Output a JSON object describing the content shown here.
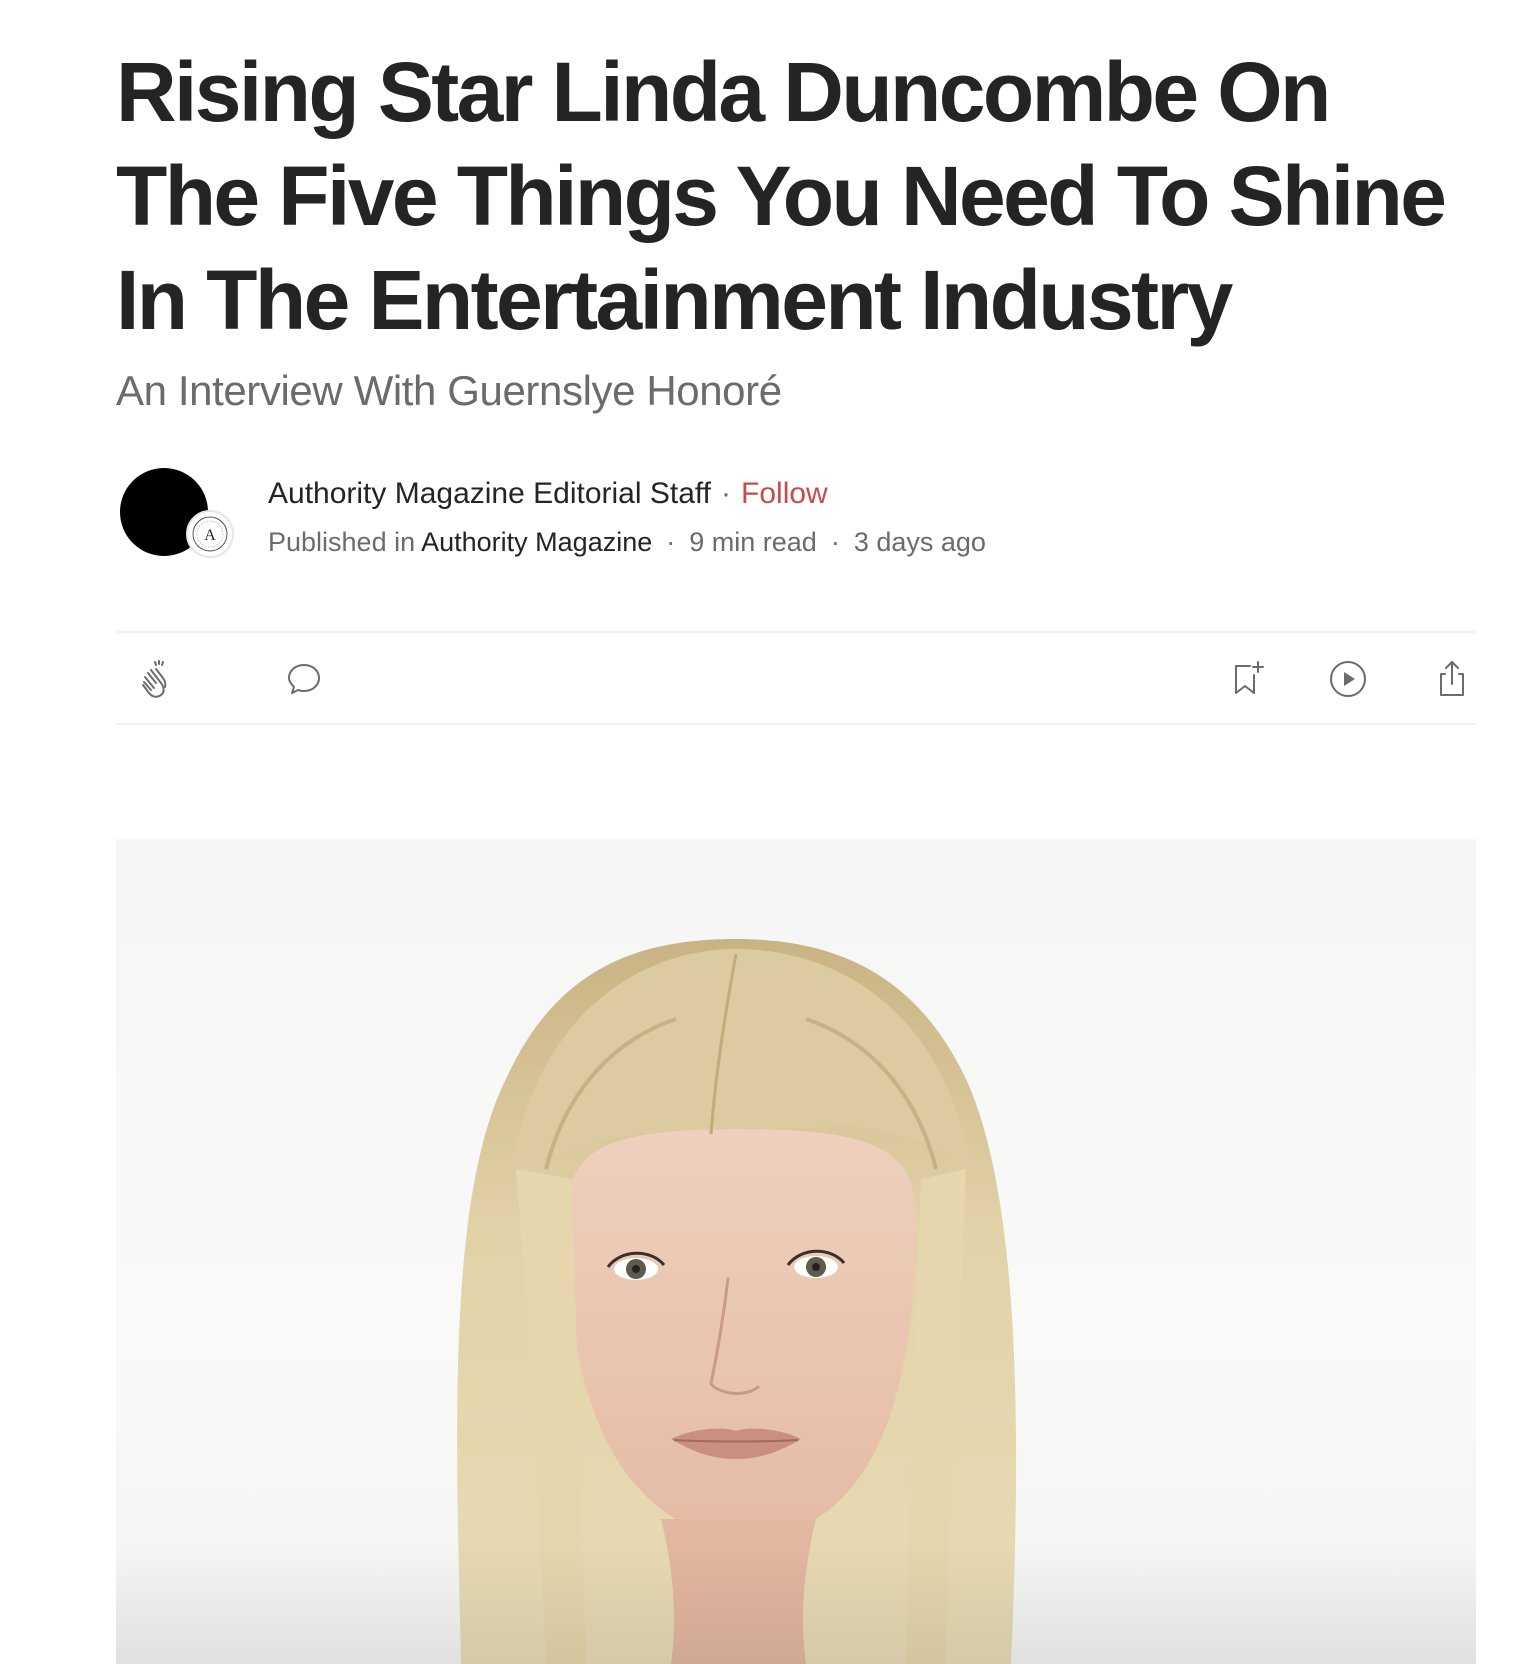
{
  "article": {
    "title": "Rising Star Linda Duncombe On The Five Things You Need To Shine In The Entertainment Industry",
    "subtitle": "An Interview With Guernslye Honoré"
  },
  "author": {
    "name": "Authority Magazine Editorial Staff",
    "follow_label": "Follow",
    "separator": "·"
  },
  "meta": {
    "published_in_label": "Published in",
    "publication": "Authority Magazine",
    "read_time": "9 min read",
    "posted": "3 days ago",
    "separator": "·"
  },
  "publication_logo": {
    "letter": "A"
  },
  "actions": {
    "icons": [
      "clap-icon",
      "comment-icon",
      "bookmark-add-icon",
      "listen-play-icon",
      "share-icon"
    ]
  },
  "colors": {
    "text": "#242424",
    "muted": "#6b6b6b",
    "follow": "#c94a4a",
    "divider": "#f0f0f0"
  }
}
